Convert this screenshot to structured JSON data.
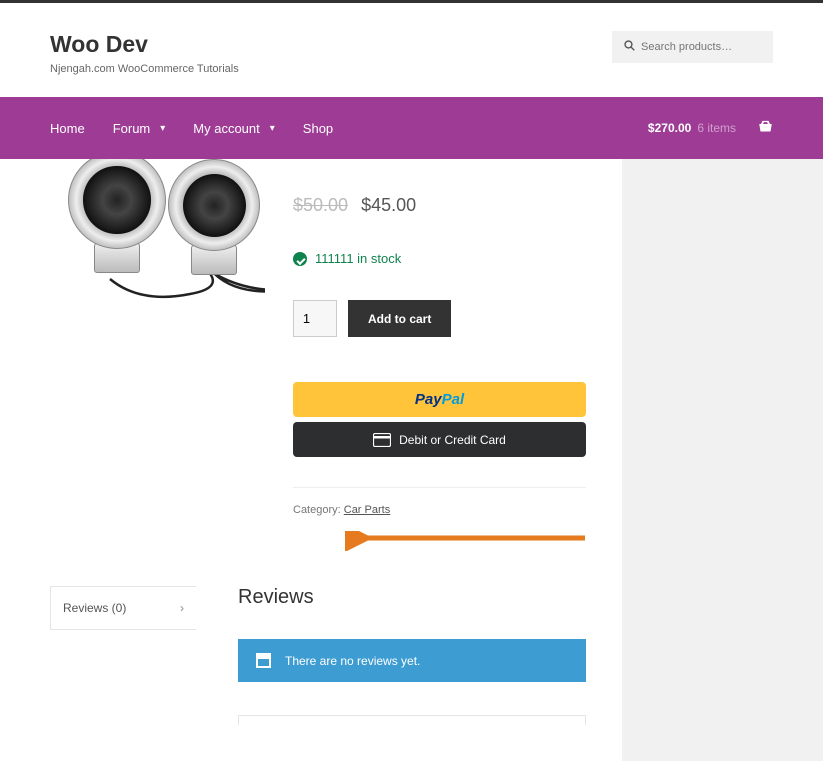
{
  "header": {
    "title": "Woo Dev",
    "tagline": "Njengah.com WooCommerce Tutorials",
    "search_placeholder": "Search products…"
  },
  "nav": {
    "items": [
      {
        "label": "Home",
        "has_caret": false
      },
      {
        "label": "Forum",
        "has_caret": true
      },
      {
        "label": "My account",
        "has_caret": true
      },
      {
        "label": "Shop",
        "has_caret": false
      }
    ],
    "cart_total": "$270.00",
    "cart_items": "6 items"
  },
  "product": {
    "old_price": "$50.00",
    "price": "$45.00",
    "stock_text": "111111 in stock",
    "quantity": "1",
    "add_to_cart_label": "Add to cart",
    "paypal_pay": "Pay",
    "paypal_pal": "Pal",
    "debit_credit_label": "Debit or Credit Card",
    "category_prefix": "Category: ",
    "category_link": "Car Parts"
  },
  "tabs": {
    "reviews_tab": "Reviews (0)",
    "panel_heading": "Reviews",
    "no_reviews_text": "There are no reviews yet."
  }
}
